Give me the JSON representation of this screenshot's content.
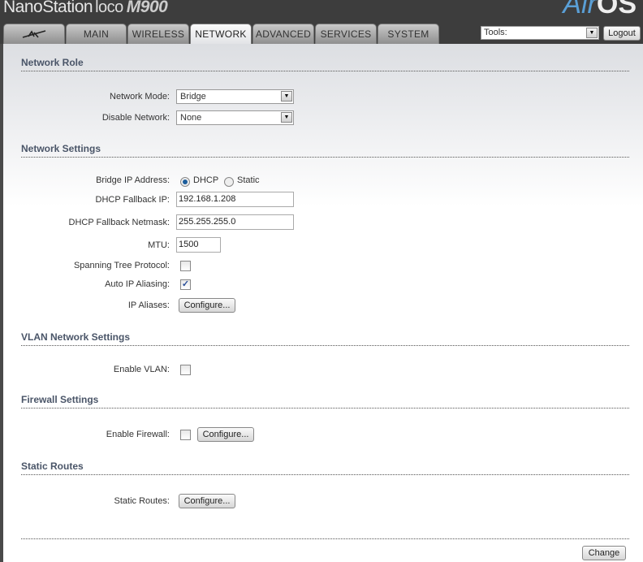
{
  "header": {
    "brand": "NanoStation",
    "brand_sub": "loco",
    "model": "M900",
    "logo_a": "Air",
    "logo_b": "OS"
  },
  "tabs": [
    {
      "label": ""
    },
    {
      "label": "MAIN"
    },
    {
      "label": "WIRELESS"
    },
    {
      "label": "NETWORK"
    },
    {
      "label": "ADVANCED"
    },
    {
      "label": "SERVICES"
    },
    {
      "label": "SYSTEM"
    }
  ],
  "tools": {
    "value": "Tools:",
    "logout": "Logout"
  },
  "network_role": {
    "title": "Network Role",
    "mode_label": "Network Mode:",
    "mode_value": "Bridge",
    "disable_label": "Disable Network:",
    "disable_value": "None"
  },
  "network_settings": {
    "title": "Network Settings",
    "bridge_ip_label": "Bridge IP Address:",
    "dhcp": "DHCP",
    "static": "Static",
    "fallback_ip_label": "DHCP Fallback IP:",
    "fallback_ip": "192.168.1.208",
    "netmask_label": "DHCP Fallback Netmask:",
    "netmask": "255.255.255.0",
    "mtu_label": "MTU:",
    "mtu": "1500",
    "stp_label": "Spanning Tree Protocol:",
    "alias_label": "Auto IP Aliasing:",
    "ip_aliases_label": "IP Aliases:",
    "configure": "Configure..."
  },
  "vlan": {
    "title": "VLAN Network Settings",
    "enable_label": "Enable VLAN:"
  },
  "firewall": {
    "title": "Firewall Settings",
    "enable_label": "Enable Firewall:",
    "configure": "Configure..."
  },
  "routes": {
    "title": "Static Routes",
    "label": "Static Routes:",
    "configure": "Configure..."
  },
  "change": "Change"
}
